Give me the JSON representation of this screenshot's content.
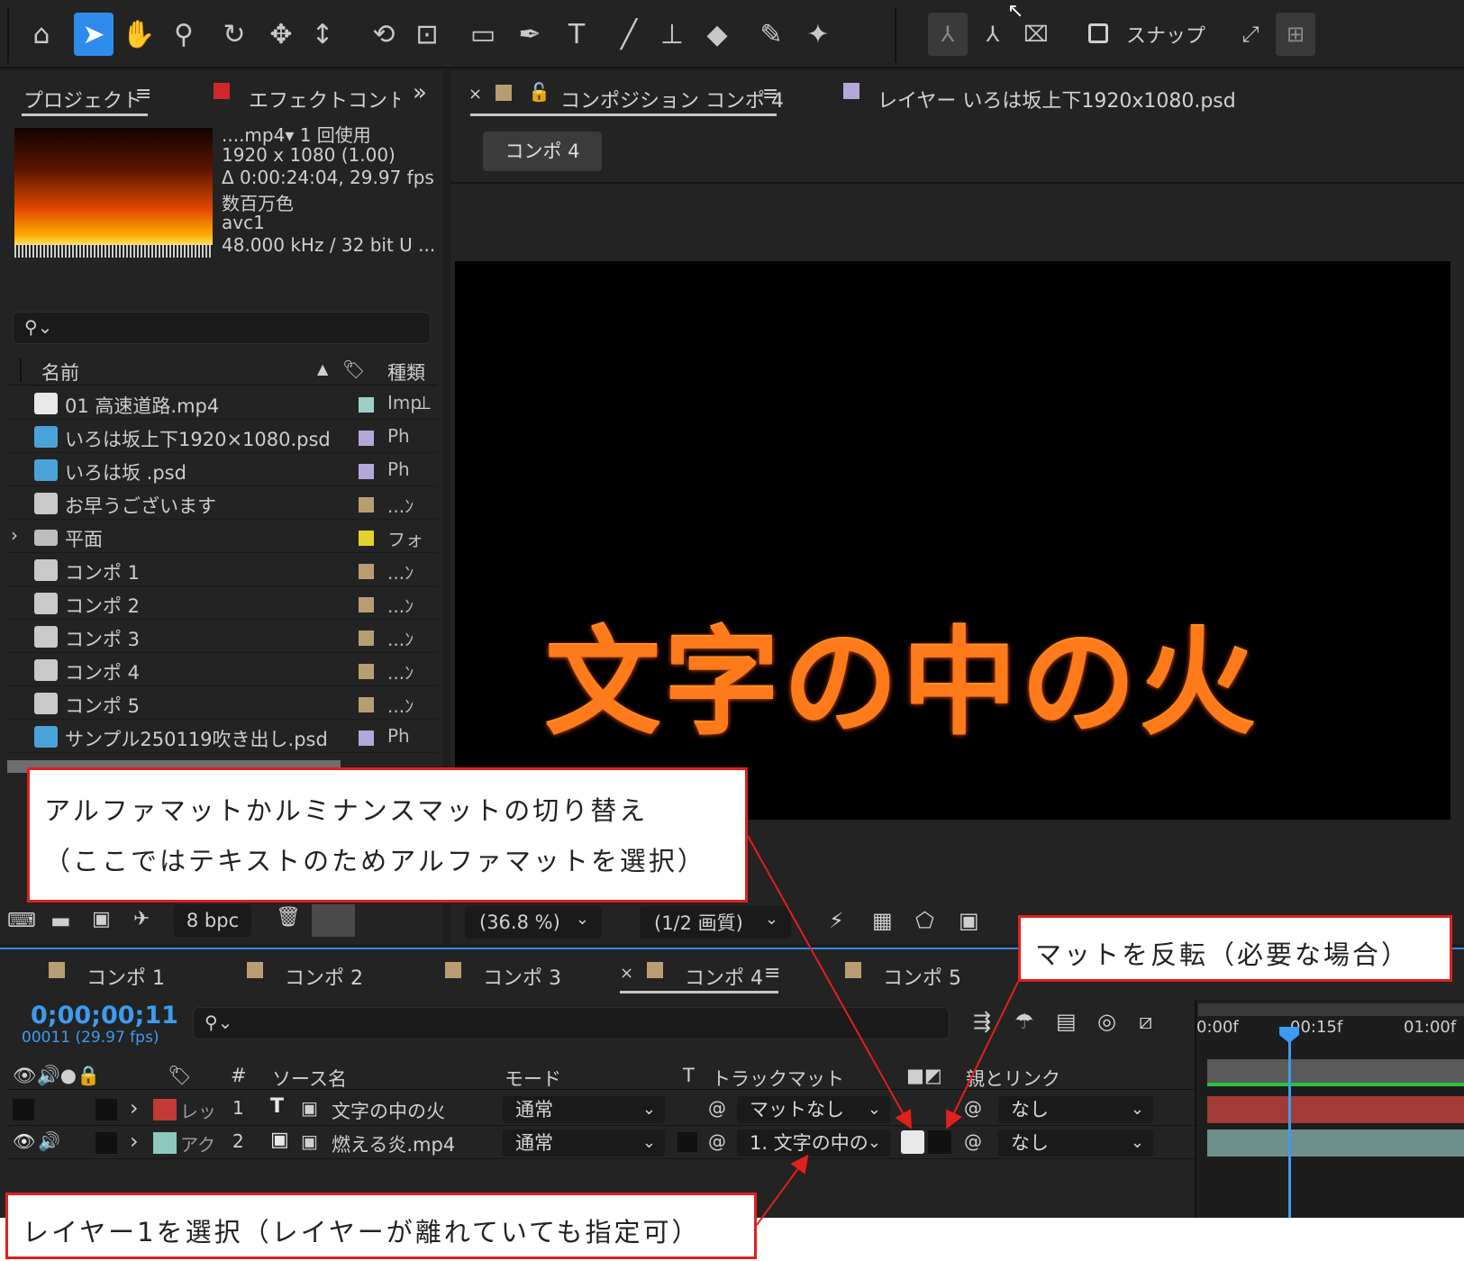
{
  "toolbar": {
    "tools": [
      {
        "name": "home-icon",
        "glyph": "⌂"
      },
      {
        "name": "selection-arrow-icon",
        "glyph": "➤"
      },
      {
        "name": "hand-icon",
        "glyph": "✋"
      },
      {
        "name": "zoom-icon",
        "glyph": "⚲"
      },
      {
        "name": "orbit-camera-icon",
        "glyph": "↻"
      },
      {
        "name": "pan-camera-icon",
        "glyph": "✥"
      },
      {
        "name": "dolly-camera-icon",
        "glyph": "↕"
      },
      {
        "name": "rotate-icon",
        "glyph": "⟲"
      },
      {
        "name": "anchor-point-icon",
        "glyph": "⊡"
      },
      {
        "name": "rectangle-tool-icon",
        "glyph": "▭"
      },
      {
        "name": "pen-tool-icon",
        "glyph": "✒"
      },
      {
        "name": "type-tool-icon",
        "glyph": "T"
      },
      {
        "name": "brush-tool-icon",
        "glyph": "╱"
      },
      {
        "name": "clone-stamp-icon",
        "glyph": "⊥"
      },
      {
        "name": "eraser-icon",
        "glyph": "◆"
      },
      {
        "name": "roto-brush-icon",
        "glyph": "✎"
      },
      {
        "name": "puppet-pin-icon",
        "glyph": "✦"
      }
    ],
    "axis_tools": [
      {
        "name": "local-axis-icon",
        "glyph": "⅄"
      },
      {
        "name": "world-axis-icon",
        "glyph": "⅄"
      },
      {
        "name": "view-axis-icon",
        "glyph": "⌧"
      }
    ],
    "snap_label": "スナップ"
  },
  "project_panel": {
    "tab_project": "プロジェクト",
    "tab_effects": "エフェクトコントロー",
    "overflow": "»",
    "meta": {
      "line1": "....mp4▾ 1 回使用",
      "line2": "1920 x 1080 (1.00)",
      "line3": "Δ 0:00:24:04, 29.97 fps",
      "line4": "数百万色",
      "line5": "avc1",
      "line6": "48.000 kHz / 32 bit U ..."
    },
    "col_name": "名前",
    "col_type": "種類",
    "items": [
      {
        "name": "01 高速道路.mp4",
        "label_color": "#9ecfc7",
        "type": "Imp",
        "icon": "footage-icon",
        "icon_color": "#e8e8e8"
      },
      {
        "name": "いろは坂上下1920×1080.psd",
        "label_color": "#b4a8d8",
        "type": "Ph",
        "icon": "psd-icon",
        "icon_color": "#4aa3d8"
      },
      {
        "name": "いろは坂 .psd",
        "label_color": "#b4a8d8",
        "type": "Ph",
        "icon": "psd-icon",
        "icon_color": "#4aa3d8"
      },
      {
        "name": "お早うございます",
        "label_color": "#b89d73",
        "type": "...ﾝ",
        "icon": "composition-icon",
        "icon_color": "#c9c9c9"
      },
      {
        "name": "平面",
        "label_color": "#e2d22e",
        "type": "フォ",
        "icon": "folder-icon",
        "icon_color": "#bdbdbd"
      },
      {
        "name": "コンポ 1",
        "label_color": "#b89d73",
        "type": "...ﾝ",
        "icon": "composition-icon",
        "icon_color": "#c9c9c9"
      },
      {
        "name": "コンポ 2",
        "label_color": "#b89d73",
        "type": "...ﾝ",
        "icon": "composition-icon",
        "icon_color": "#c9c9c9"
      },
      {
        "name": "コンポ 3",
        "label_color": "#b89d73",
        "type": "...ﾝ",
        "icon": "composition-icon",
        "icon_color": "#c9c9c9"
      },
      {
        "name": "コンポ 4",
        "label_color": "#b89d73",
        "type": "...ﾝ",
        "icon": "composition-icon",
        "icon_color": "#c9c9c9"
      },
      {
        "name": "コンポ 5",
        "label_color": "#b89d73",
        "type": "...ﾝ",
        "icon": "composition-icon",
        "icon_color": "#c9c9c9"
      },
      {
        "name": "サンプル250119吹き出し.psd",
        "label_color": "#b4a8d8",
        "type": "Ph",
        "icon": "psd-icon",
        "icon_color": "#4aa3d8"
      }
    ],
    "bpc": "8 bpc"
  },
  "comp_panel": {
    "close": "×",
    "tab_comp": "コンポジション コンポ 4",
    "tab_layer": "レイヤー いろは坂上下1920x1080.psd",
    "breadcrumb": "コンポ 4",
    "canvas_text": "文字の中の火",
    "zoom": "(36.8 %)",
    "quality": "(1/2 画質)"
  },
  "timeline": {
    "tabs": [
      "コンポ 1",
      "コンポ 2",
      "コンポ 3",
      "コンポ 4",
      "コンポ 5"
    ],
    "close": "×",
    "timecode": "0;00;00;11",
    "frames": "00011 (29.97 fps)",
    "headers": {
      "num": "#",
      "source": "ソース名",
      "mode": "モード",
      "t": "T",
      "trackmatte": "トラックマット",
      "parent": "親とリンク"
    },
    "ruler": {
      "start": "0:00f",
      "mid": "00:15f",
      "end": "01:00f"
    },
    "layers": [
      {
        "label": "レッ",
        "label_color": "#c23a37",
        "num": "1",
        "type_glyph": "T",
        "source": "文字の中の火",
        "mode": "通常",
        "matte": "マットなし",
        "parent": "なし",
        "bar_color": "#a23a37"
      },
      {
        "label": "アク",
        "label_color": "#8fc8c0",
        "num": "2",
        "type_glyph": "▣",
        "source": "燃える炎.mp4",
        "mode": "通常",
        "matte": "1. 文字の中の",
        "parent": "なし",
        "bar_color": "#6e8f8a"
      }
    ]
  },
  "annotations": {
    "top_line1": "アルファマットかルミナンスマットの切り替え",
    "top_line2": "（ここではテキストのためアルファマットを選択）",
    "right": "マットを反転（必要な場合）",
    "bottom": "レイヤー1を選択（レイヤーが離れていても指定可）",
    "border_color": "#e0201c"
  }
}
